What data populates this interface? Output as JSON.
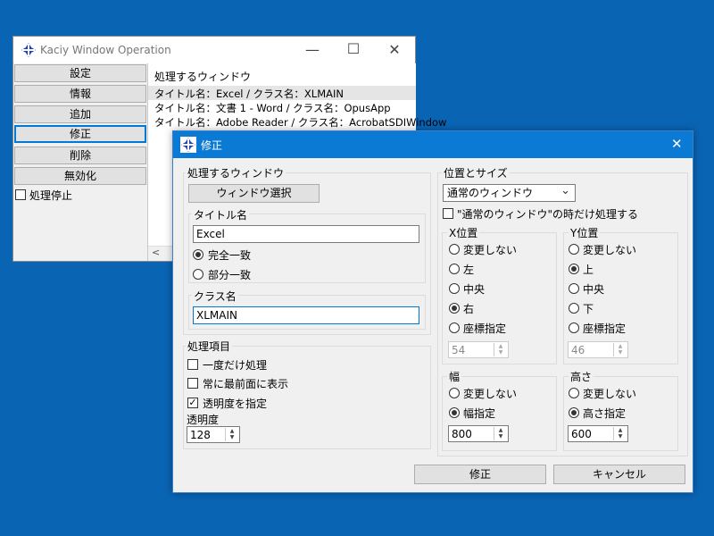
{
  "main_window": {
    "title": "Kaciy Window Operation",
    "minimize": "—",
    "maximize": "☐",
    "close": "✕",
    "buttons": [
      "設定",
      "情報",
      "追加",
      "修正",
      "削除",
      "無効化"
    ],
    "pause_label": "処理停止",
    "list_header": "処理するウィンドウ",
    "list_rows": [
      "タイトル名：Excel / クラス名：XLMAIN",
      "タイトル名：文書 1 - Word / クラス名：OpusApp",
      "タイトル名：Adobe Reader / クラス名：AcrobatSDIWindow"
    ],
    "scroll_left": "<"
  },
  "dialog": {
    "title": "修正",
    "close": "✕",
    "target_window": {
      "group_label": "処理するウィンドウ",
      "select_button": "ウィンドウ選択",
      "title_group_label": "タイトル名",
      "title_value": "Excel",
      "exact_match": "完全一致",
      "partial_match": "部分一致",
      "class_group_label": "クラス名",
      "class_value": "XLMAIN"
    },
    "process_items": {
      "group_label": "処理項目",
      "once_only": "一度だけ処理",
      "always_on_top": "常に最前面に表示",
      "set_opacity": "透明度を指定",
      "opacity_label": "透明度",
      "opacity_value": "128"
    },
    "position_size": {
      "group_label": "位置とサイズ",
      "window_state": "通常のウィンドウ",
      "only_normal_label": "\"通常のウィンドウ\"の時だけ処理する",
      "x": {
        "label": "X位置",
        "options": [
          "変更しない",
          "左",
          "中央",
          "右",
          "座標指定"
        ],
        "selected": 3,
        "coord_value": "54"
      },
      "y": {
        "label": "Y位置",
        "options": [
          "変更しない",
          "上",
          "中央",
          "下",
          "座標指定"
        ],
        "selected": 1,
        "coord_value": "46"
      },
      "width": {
        "label": "幅",
        "options": [
          "変更しない",
          "幅指定"
        ],
        "selected": 1,
        "value": "800"
      },
      "height": {
        "label": "高さ",
        "options": [
          "変更しない",
          "高さ指定"
        ],
        "selected": 1,
        "value": "600"
      }
    },
    "ok_button": "修正",
    "cancel_button": "キャンセル"
  },
  "icons": {
    "app_logo": "blue-diamond-cross-icon",
    "spin_up": "▲",
    "spin_down": "▼",
    "dropdown": "⌄",
    "check": "✓"
  },
  "colors": {
    "desktop": "#0a64b4",
    "dialog_title": "#0a7ad4",
    "focus": "#0078d7"
  }
}
